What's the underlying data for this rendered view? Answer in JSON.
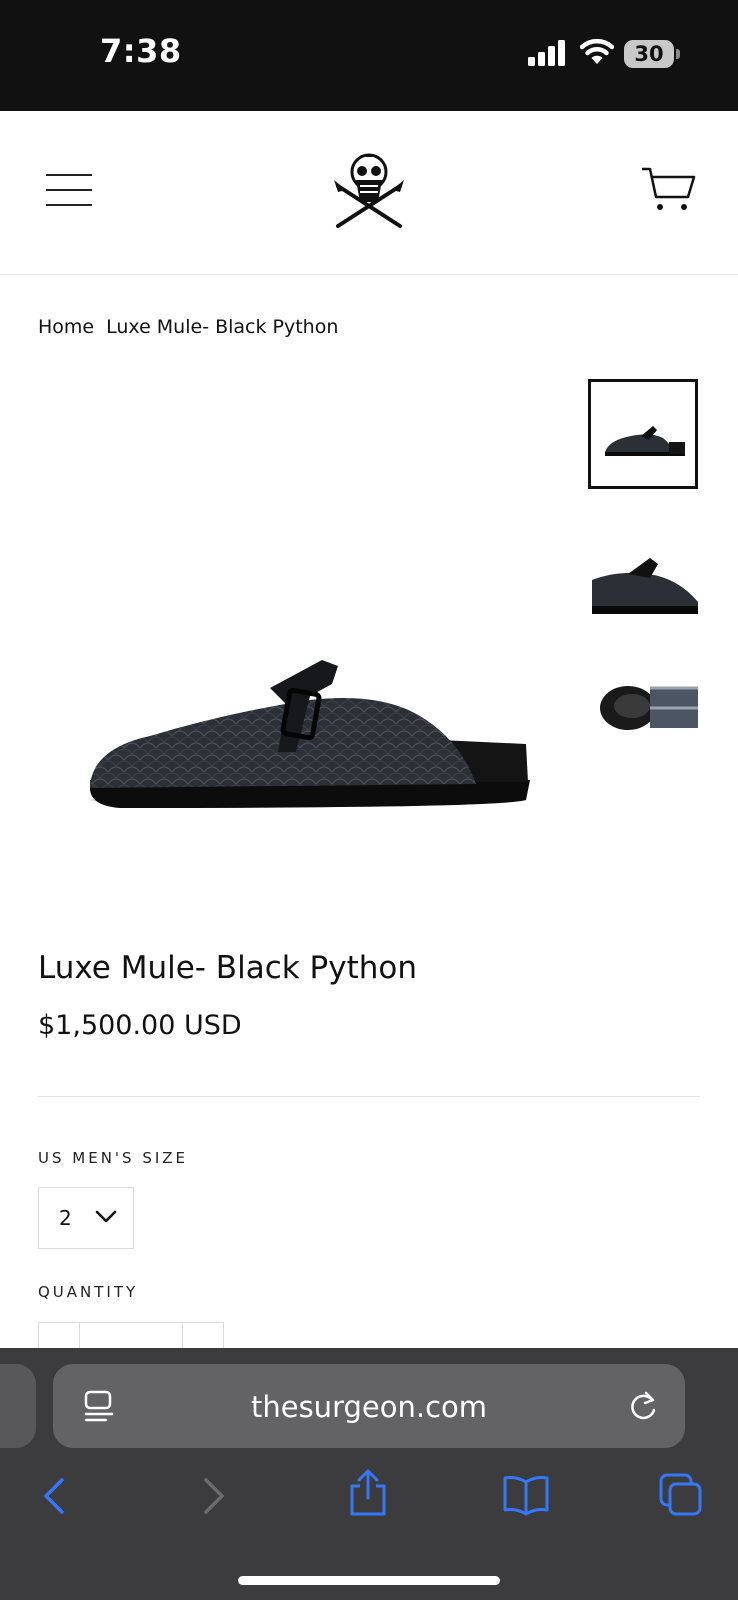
{
  "status_bar": {
    "time": "7:38",
    "battery": "30",
    "icons": [
      "signal-icon",
      "wifi-icon",
      "battery-icon"
    ]
  },
  "header": {
    "icons": [
      "menu-icon",
      "skull-logo-icon",
      "cart-icon"
    ]
  },
  "breadcrumb": {
    "home": "Home",
    "current": "Luxe Mule- Black Python"
  },
  "gallery": {
    "thumbnail_count": 3,
    "selected_thumbnail": 1
  },
  "product": {
    "title": "Luxe Mule- Black Python",
    "price": "$1,500.00 USD",
    "size_label": "US MEN'S SIZE",
    "size_value": "2",
    "quantity_label": "QUANTITY"
  },
  "browser": {
    "url": "thesurgeon.com",
    "icons": [
      "reader-icon",
      "reload-icon",
      "back-icon",
      "forward-icon",
      "share-icon",
      "bookmarks-icon",
      "tabs-icon"
    ],
    "accent_color": "#3478f6",
    "disabled_color": "#6b6b6e"
  }
}
